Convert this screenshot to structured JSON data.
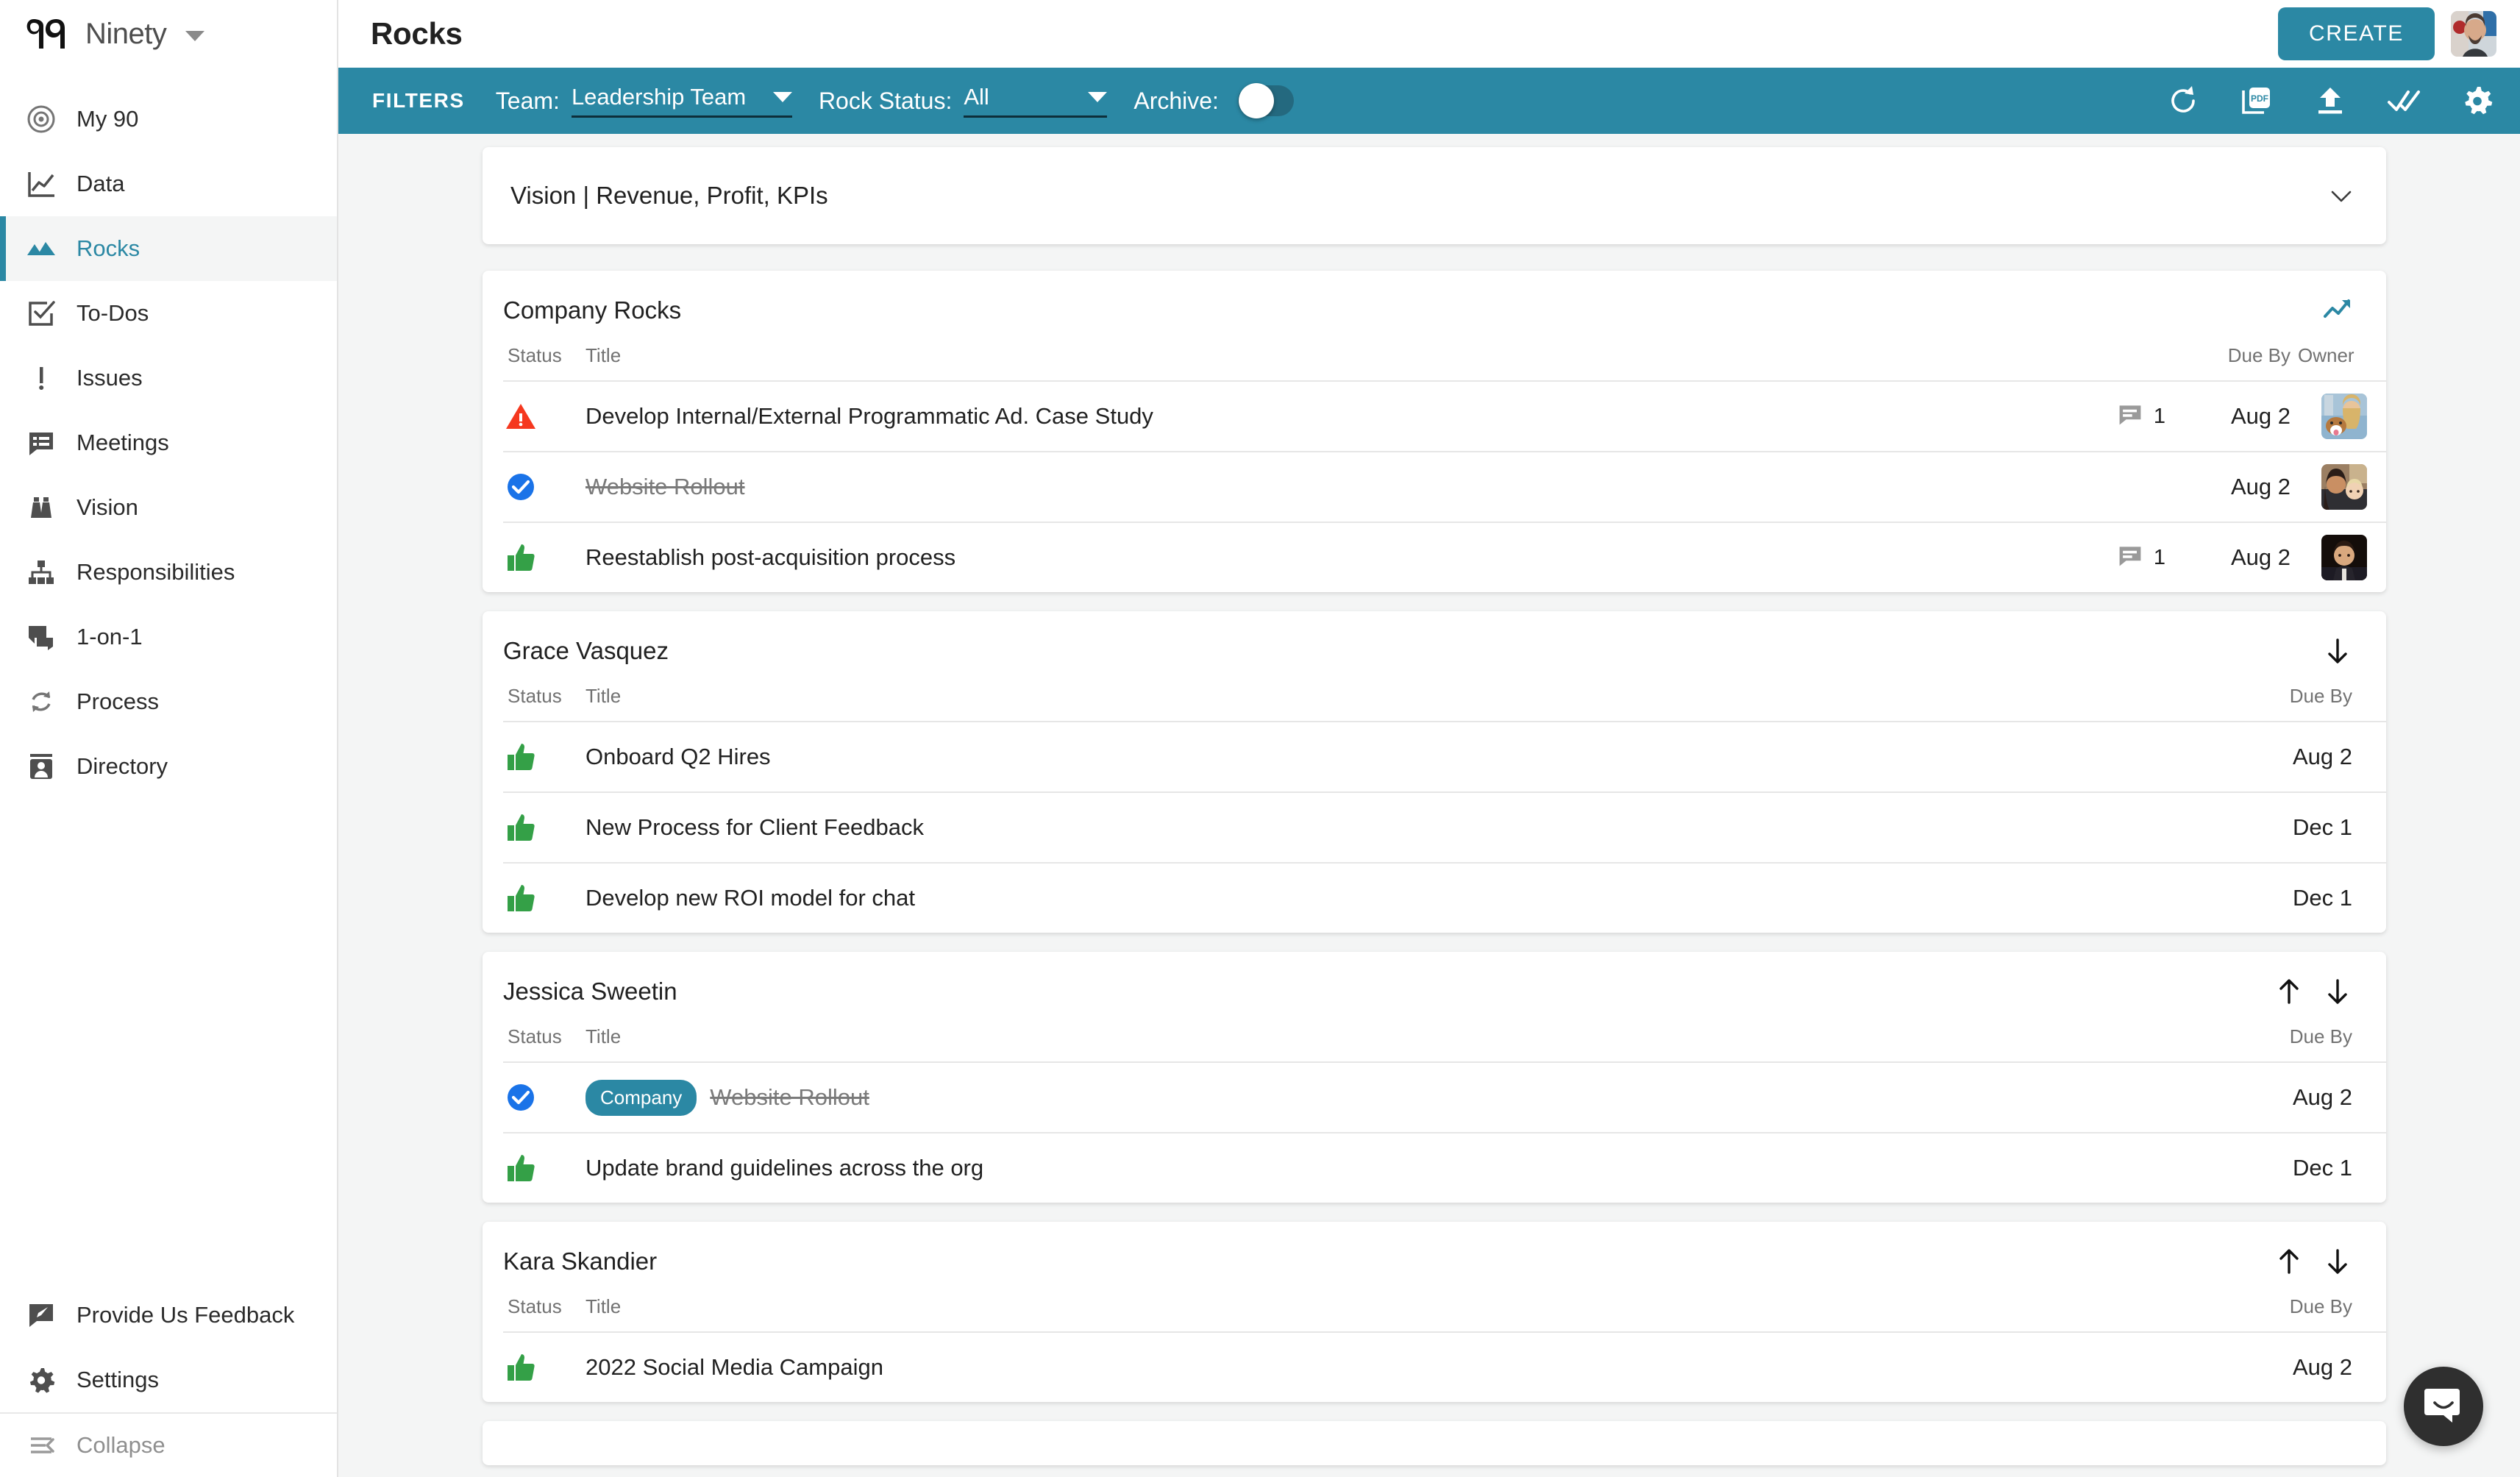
{
  "brand": {
    "name": "Ninety",
    "logo_icon": "ninety-logo-icon",
    "caret_icon": "chevron-down-icon"
  },
  "sidebar": {
    "items": [
      {
        "label": "My 90",
        "icon": "target-icon",
        "active": false
      },
      {
        "label": "Data",
        "icon": "line-chart-icon",
        "active": false
      },
      {
        "label": "Rocks",
        "icon": "mountains-icon",
        "active": true
      },
      {
        "label": "To-Dos",
        "icon": "checkbox-icon",
        "active": false
      },
      {
        "label": "Issues",
        "icon": "exclamation-icon",
        "active": false
      },
      {
        "label": "Meetings",
        "icon": "speech-list-icon",
        "active": false
      },
      {
        "label": "Vision",
        "icon": "binoculars-icon",
        "active": false
      },
      {
        "label": "Responsibilities",
        "icon": "org-chart-icon",
        "active": false
      },
      {
        "label": "1-on-1",
        "icon": "two-speech-icon",
        "active": false
      },
      {
        "label": "Process",
        "icon": "refresh-cycle-icon",
        "active": false
      },
      {
        "label": "Directory",
        "icon": "contact-card-icon",
        "active": false
      }
    ],
    "bottom": [
      {
        "label": "Provide Us Feedback",
        "icon": "feedback-pencil-icon"
      },
      {
        "label": "Settings",
        "icon": "gear-icon"
      },
      {
        "label": "Collapse",
        "icon": "collapse-left-icon"
      }
    ]
  },
  "topbar": {
    "title": "Rocks",
    "create_label": "CREATE",
    "avatar_icon": "user-avatar"
  },
  "filterbar": {
    "filters_label": "FILTERS",
    "team_label": "Team:",
    "team_value": "Leadership Team",
    "rock_status_label": "Rock Status:",
    "rock_status_value": "All",
    "archive_label": "Archive:",
    "archive_on": false,
    "icons": [
      {
        "name": "refresh-icon"
      },
      {
        "name": "pdf-export-icon",
        "text": "PDF"
      },
      {
        "name": "upload-icon"
      },
      {
        "name": "double-check-icon"
      },
      {
        "name": "gear-icon"
      }
    ]
  },
  "vision_banner": {
    "title": "Vision | Revenue, Profit, KPIs",
    "chevron_icon": "chevron-down-icon"
  },
  "columns": {
    "status": "Status",
    "title": "Title",
    "due_by": "Due By",
    "owner": "Owner"
  },
  "sections": [
    {
      "title": "Company Rocks",
      "actions": [
        "trending-up-icon"
      ],
      "show_owner": true,
      "rows": [
        {
          "status": "off-track",
          "title": "Develop Internal/External Programmatic Ad. Case Study",
          "badge": "",
          "comments": "1",
          "due": "Aug 2",
          "owner_alt": "owner-avatar",
          "done": false
        },
        {
          "status": "complete",
          "title": "Website Rollout",
          "badge": "",
          "comments": "",
          "due": "Aug 2",
          "owner_alt": "owner-avatar",
          "done": true
        },
        {
          "status": "on-track",
          "title": "Reestablish post-acquisition process",
          "badge": "",
          "comments": "1",
          "due": "Aug 2",
          "owner_alt": "owner-avatar",
          "done": false
        }
      ]
    },
    {
      "title": "Grace Vasquez",
      "actions": [
        "arrow-down-icon"
      ],
      "show_owner": false,
      "rows": [
        {
          "status": "on-track",
          "title": "Onboard Q2 Hires",
          "badge": "",
          "comments": "",
          "due": "Aug 2",
          "done": false
        },
        {
          "status": "on-track",
          "title": "New Process for Client Feedback",
          "badge": "",
          "comments": "",
          "due": "Dec 1",
          "done": false
        },
        {
          "status": "on-track",
          "title": "Develop new ROI model for chat",
          "badge": "",
          "comments": "",
          "due": "Dec 1",
          "done": false
        }
      ]
    },
    {
      "title": "Jessica Sweetin",
      "actions": [
        "arrow-up-icon",
        "arrow-down-icon"
      ],
      "show_owner": false,
      "rows": [
        {
          "status": "complete",
          "title": "Website Rollout",
          "badge": "Company",
          "comments": "",
          "due": "Aug 2",
          "done": true
        },
        {
          "status": "on-track",
          "title": "Update brand guidelines across the org",
          "badge": "",
          "comments": "",
          "due": "Dec 1",
          "done": false
        }
      ]
    },
    {
      "title": "Kara Skandier",
      "actions": [
        "arrow-up-icon",
        "arrow-down-icon"
      ],
      "show_owner": false,
      "rows": [
        {
          "status": "on-track",
          "title": "2022 Social Media Campaign",
          "badge": "",
          "comments": "",
          "due": "Aug 2",
          "done": false
        }
      ]
    }
  ],
  "intercom": {
    "icon": "intercom-chat-icon"
  },
  "colors": {
    "accent_teal": "#2b88a4",
    "status_off_track": "#f5381f",
    "status_complete": "#1a73e8",
    "status_on_track": "#34a047",
    "page_bg": "#f4f5f5"
  }
}
